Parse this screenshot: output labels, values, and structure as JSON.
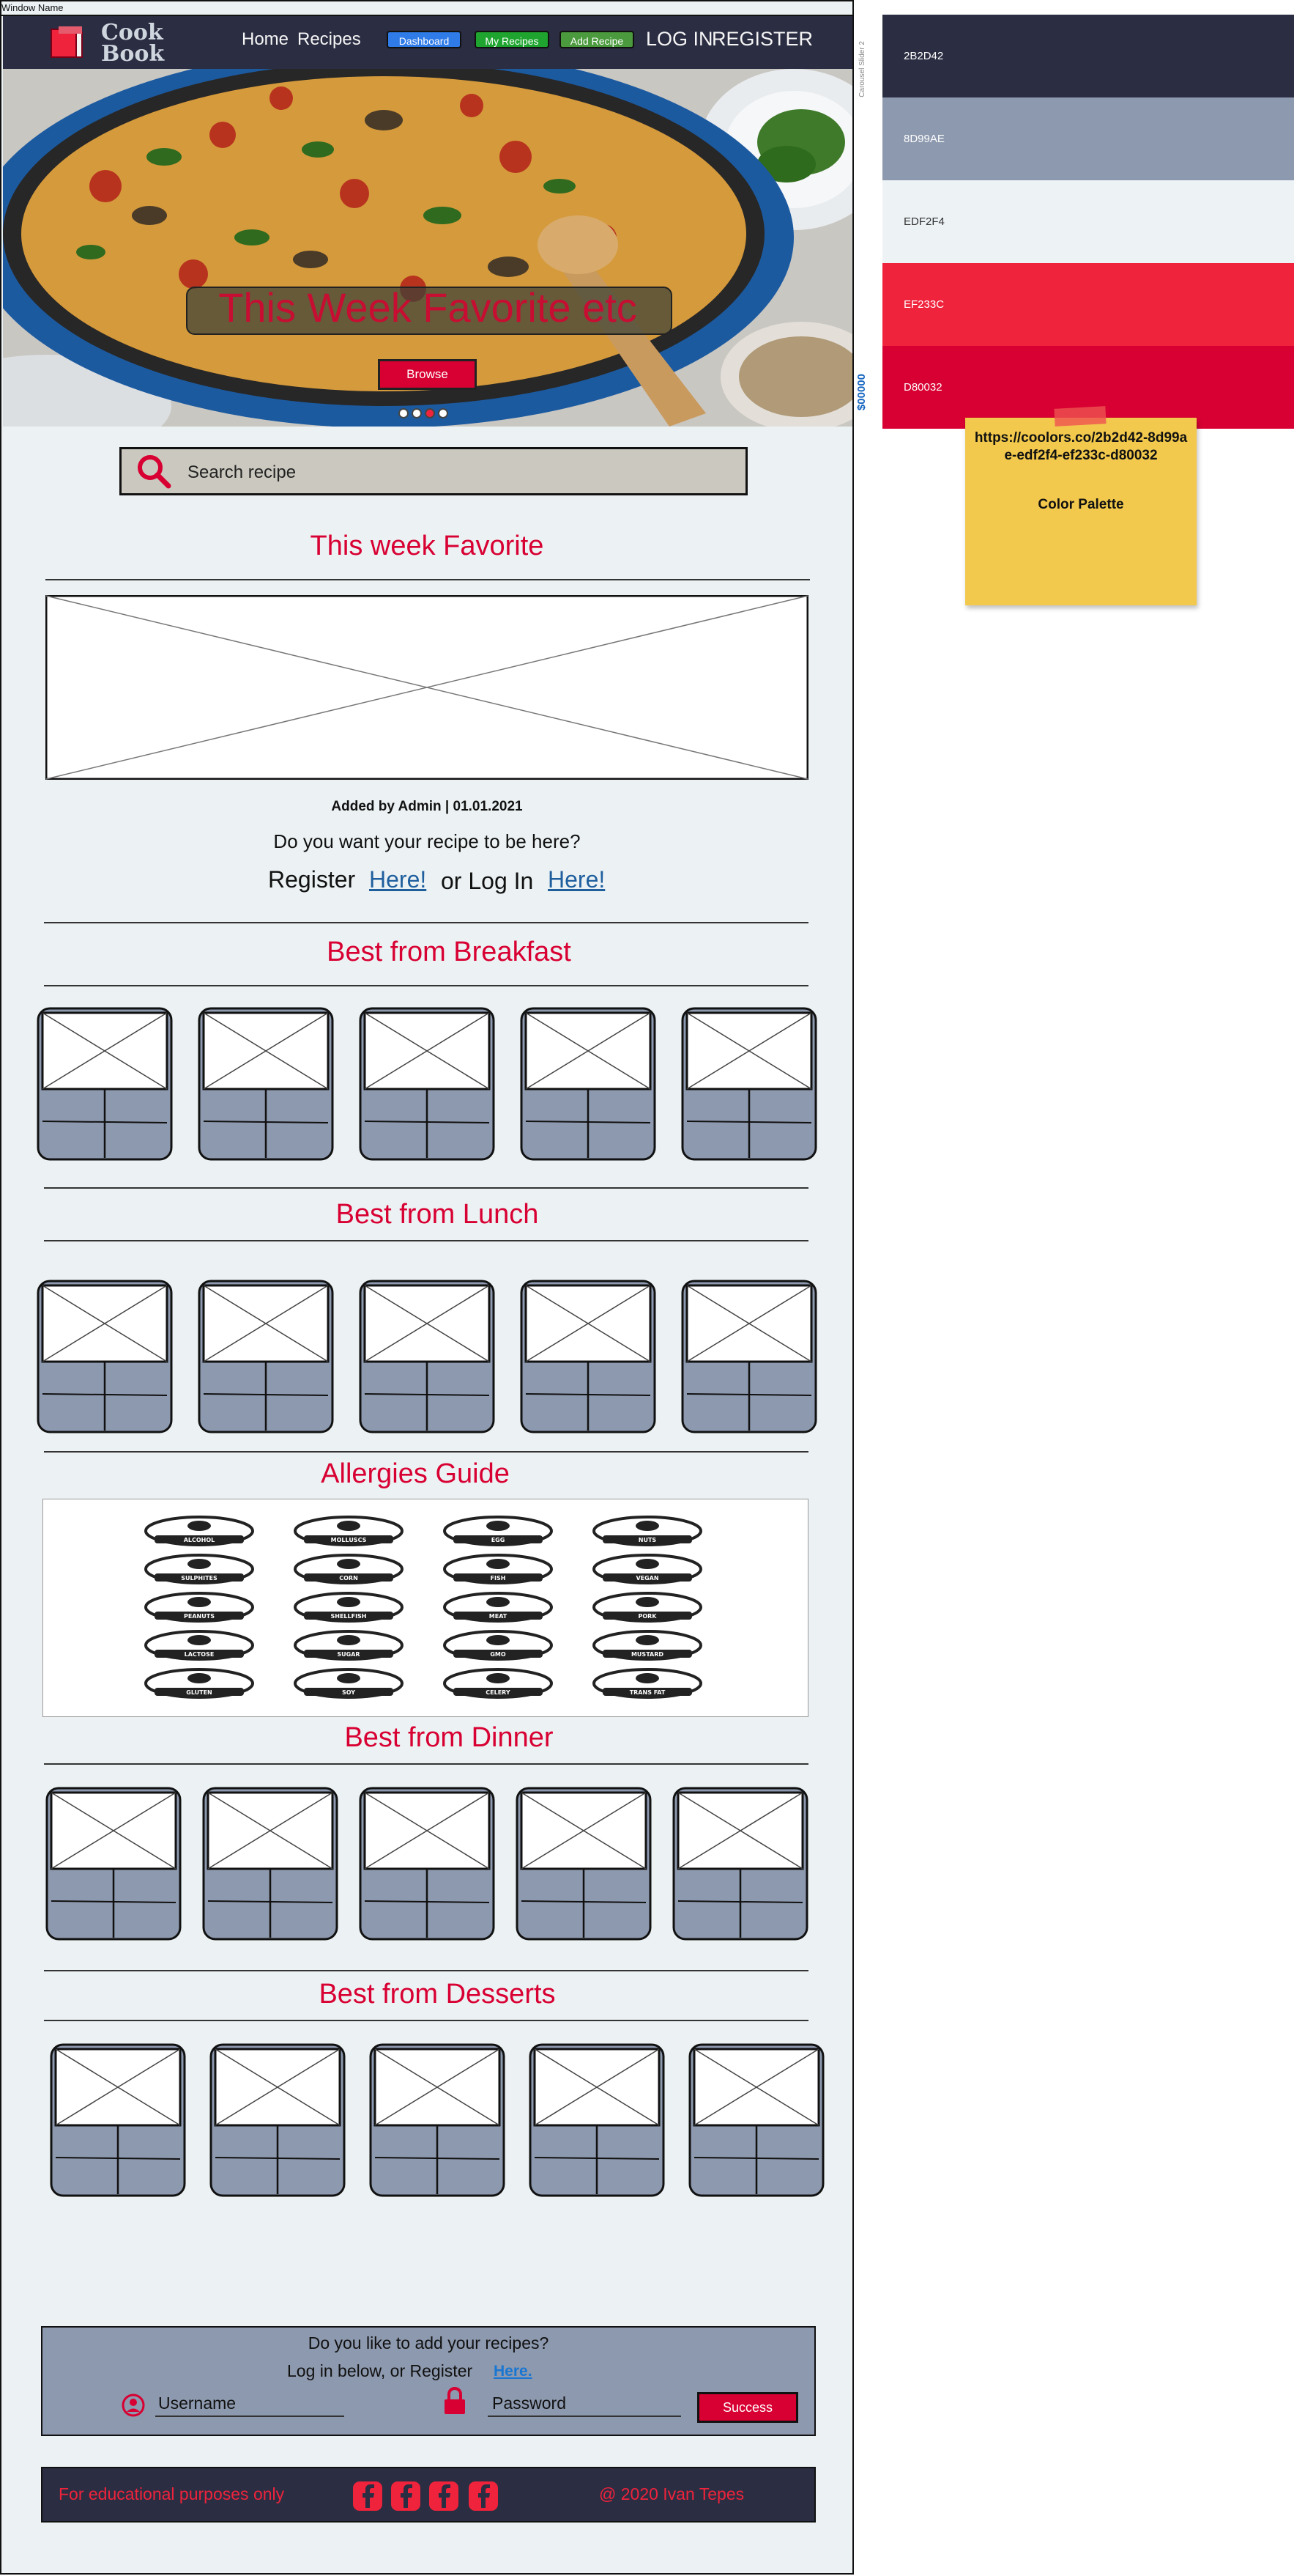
{
  "window": {
    "title": "Window Name"
  },
  "header": {
    "logo_line1": "Cook",
    "logo_line2": "Book",
    "nav": [
      "Home",
      "Recipes"
    ],
    "buttons": [
      {
        "label": "Dashboard",
        "color": "#2f7be8"
      },
      {
        "label": "My Recipes",
        "color": "#1fa52f"
      },
      {
        "label": "Add Recipe",
        "color": "#4b9a3e"
      }
    ],
    "login": "LOG IN",
    "register": "REGISTER"
  },
  "hero": {
    "caption": "This Week Favorite etc",
    "browse": "Browse",
    "side_label": "Carousel Slider 2",
    "side_code": "$00000",
    "dots": 4,
    "active_dot": 3
  },
  "search": {
    "placeholder": "Search recipe"
  },
  "favorite": {
    "title": "This week Favorite",
    "added_by": "Added by Admin | 01.01.2021",
    "question": "Do you want your recipe to be here?",
    "register_text": "Register",
    "register_link": "Here!",
    "or_login_text": "or Log In",
    "login_link": "Here!"
  },
  "sections": {
    "breakfast": "Best from Breakfast",
    "lunch": "Best from Lunch",
    "allergies": "Allergies Guide",
    "dinner": "Best from Dinner",
    "desserts": "Best from Desserts"
  },
  "allergens": [
    "ALCOHOL",
    "MOLLUSCS",
    "EGG",
    "NUTS",
    "SULPHITES",
    "CORN",
    "FISH",
    "VEGAN",
    "PEANUTS",
    "SHELLFISH",
    "MEAT",
    "PORK",
    "LACTOSE",
    "SUGAR",
    "GMO",
    "MUSTARD",
    "GLUTEN",
    "SOY",
    "CELERY",
    "TRANS FAT"
  ],
  "login_bar": {
    "question": "Do you like to add your recipes?",
    "line2": "Log in below, or Register",
    "link": "Here.",
    "username": "Username",
    "password": "Password",
    "submit": "Success"
  },
  "footer": {
    "left": "For educational purposes only",
    "right": "@ 2020 Ivan Tepes"
  },
  "palette": {
    "colors": [
      {
        "label": "2B2D42",
        "hex": "#2b2d42",
        "text": "#ffffff"
      },
      {
        "label": "8D99AE",
        "hex": "#8d99ae",
        "text": "#ffffff"
      },
      {
        "label": "EDF2F4",
        "hex": "#edf2f4",
        "text": "#333333"
      },
      {
        "label": "EF233C",
        "hex": "#ef233c",
        "text": "#ffffff"
      },
      {
        "label": "D80032",
        "hex": "#d80032",
        "text": "#ffffff"
      }
    ],
    "note_url": "https://coolors.co/2b2d42-8d99ae-edf2f4-ef233c-d80032",
    "note_title": "Color Palette"
  }
}
